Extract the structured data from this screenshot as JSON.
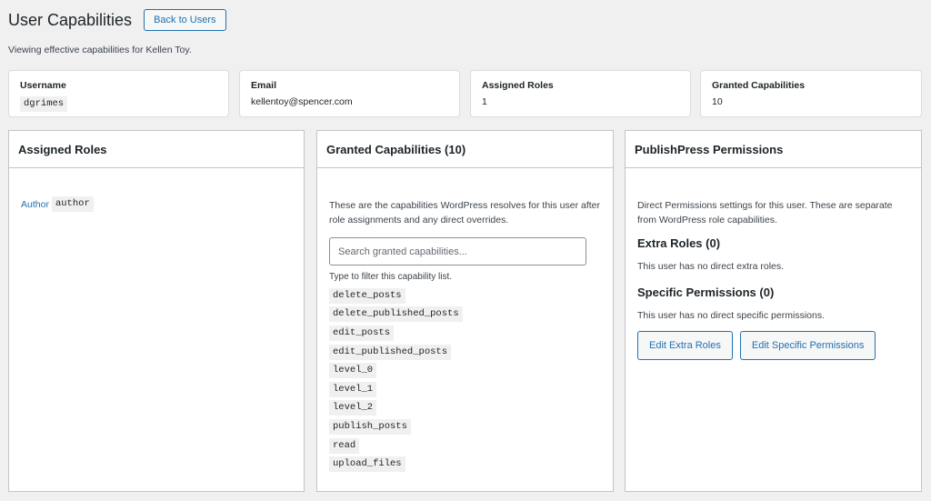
{
  "header": {
    "title": "User Capabilities",
    "back_label": "Back to Users",
    "subtitle": "Viewing effective capabilities for Kellen Toy."
  },
  "stats": [
    {
      "label": "Username",
      "value": "dgrimes"
    },
    {
      "label": "Email",
      "value": "kellentoy@spencer.com"
    },
    {
      "label": "Assigned Roles",
      "value": "1"
    },
    {
      "label": "Granted Capabilities",
      "value": "10"
    }
  ],
  "roles_panel": {
    "title": "Assigned Roles",
    "role_name": "Author",
    "role_slug": "author"
  },
  "caps_panel": {
    "title": "Granted Capabilities (10)",
    "description": "These are the capabilities WordPress resolves for this user after role assignments and any direct overrides.",
    "search_placeholder": "Search granted capabilities...",
    "hint": "Type to filter this capability list.",
    "capabilities": [
      "delete_posts",
      "delete_published_posts",
      "edit_posts",
      "edit_published_posts",
      "level_0",
      "level_1",
      "level_2",
      "publish_posts",
      "read",
      "upload_files"
    ]
  },
  "perm_panel": {
    "title": "PublishPress Permissions",
    "description": "Direct Permissions settings for this user. These are separate from WordPress role capabilities.",
    "extra_roles_title": "Extra Roles (0)",
    "extra_roles_note": "This user has no direct extra roles.",
    "specific_title": "Specific Permissions (0)",
    "specific_note": "This user has no direct specific permissions.",
    "edit_extra_label": "Edit Extra Roles",
    "edit_specific_label": "Edit Specific Permissions"
  },
  "colors": {
    "accent": "#2271b1",
    "background": "#f0f0f1"
  }
}
